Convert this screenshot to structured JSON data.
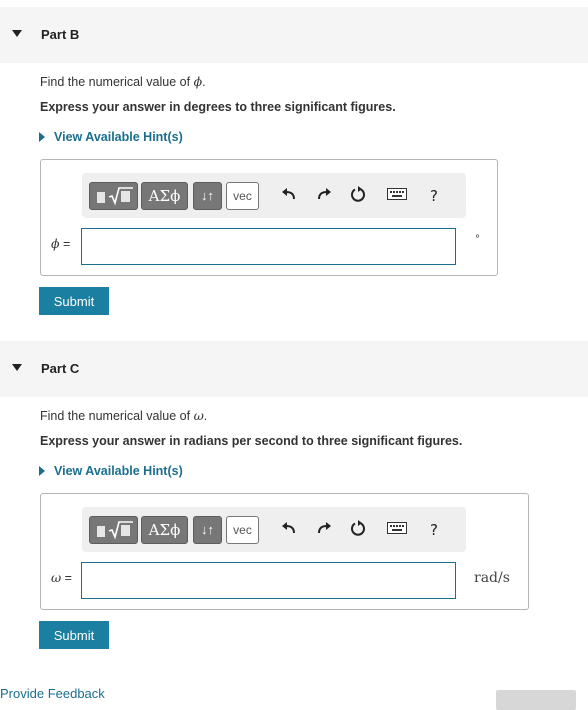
{
  "partB": {
    "title": "Part B",
    "prompt_prefix": "Find the numerical value of ",
    "prompt_symbol": "ϕ",
    "prompt_suffix": ".",
    "instruction": "Express your answer in degrees to three significant figures.",
    "hint": "View Available Hint(s)",
    "toolbar": {
      "greek": "ΑΣϕ",
      "arrows": "↓↑",
      "vec": "vec",
      "help": "?"
    },
    "var_symbol": "ϕ",
    "var_eq": " =",
    "input_value": "",
    "unit": "°",
    "submit": "Submit"
  },
  "partC": {
    "title": "Part C",
    "prompt_prefix": "Find the numerical value of ",
    "prompt_symbol": "ω",
    "prompt_suffix": ".",
    "instruction": "Express your answer in radians per second to three significant figures.",
    "hint": "View Available Hint(s)",
    "toolbar": {
      "greek": "ΑΣϕ",
      "arrows": "↓↑",
      "vec": "vec",
      "help": "?"
    },
    "var_symbol": "ω",
    "var_eq": " =",
    "input_value": "",
    "unit": "rad/s",
    "submit": "Submit"
  },
  "footer": {
    "feedback": "Provide Feedback"
  },
  "icons": {
    "expand": "triangle-down-icon",
    "hint": "triangle-right-icon",
    "template": "template-icon",
    "undo": "undo-icon",
    "redo": "redo-icon",
    "reset": "reset-icon",
    "keyboard": "keyboard-icon",
    "help": "help-icon"
  },
  "colors": {
    "accent": "#1a7fa0",
    "link": "#1a6f8f",
    "header_bg": "#f5f5f5",
    "toolbar_btn": "#777777"
  }
}
